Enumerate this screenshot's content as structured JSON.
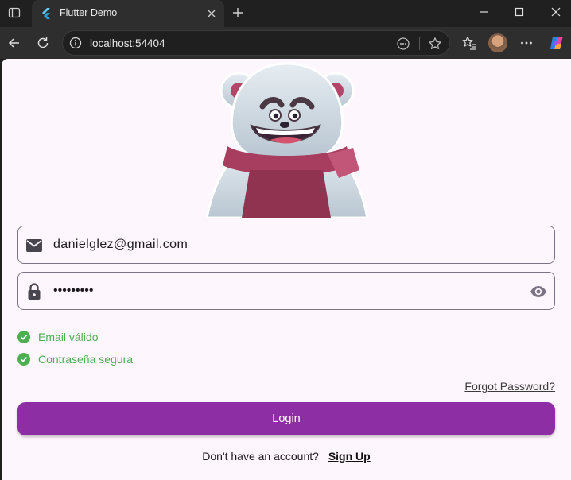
{
  "browser": {
    "tab_title": "Flutter Demo",
    "url": "localhost:54404"
  },
  "icons": {
    "tab_actions": "tab-actions-icon",
    "favicon": "flutter-logo-icon",
    "tab_close": "close-icon",
    "new_tab": "plus-icon",
    "minimize": "minimize-icon",
    "maximize": "maximize-icon",
    "close_window": "close-icon",
    "back": "back-arrow-icon",
    "refresh": "refresh-icon",
    "site_info": "info-icon",
    "reader": "more-horizontal-circle-icon",
    "favorite": "star-icon",
    "favorites": "favorites-icon",
    "menu": "more-horizontal-icon",
    "copilot": "copilot-icon",
    "email": "email-icon",
    "lock": "lock-icon",
    "visibility": "eye-icon",
    "check": "check-circle-icon"
  },
  "form": {
    "email_value": "danielglez@gmail.com",
    "password_value": "•••••••••",
    "validations": [
      "Email válido",
      "Contraseña segura"
    ],
    "forgot_password": "Forgot Password?",
    "login_label": "Login",
    "signup_prompt": "Don't have an account?",
    "signup_link": "Sign Up"
  },
  "colors": {
    "primary": "#8e2ea4",
    "success": "#4caf50",
    "page_background": "#fdf6fd",
    "field_border": "#7a7484"
  }
}
